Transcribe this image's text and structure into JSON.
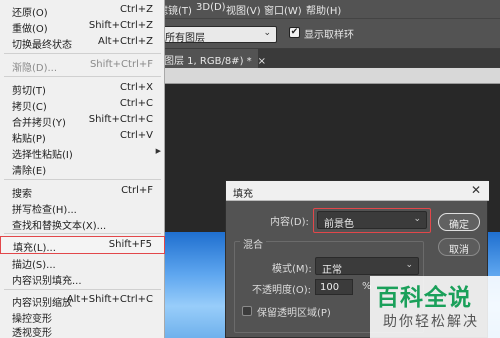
{
  "menubar": {
    "items": [
      "滤镜(T)",
      "3D(D)",
      "视图(V)",
      "窗口(W)",
      "帮助(H)"
    ]
  },
  "options_bar": {
    "sample_select_value": "所有图层",
    "show_ring_label": "显示取样环",
    "show_ring_checked": "✔"
  },
  "document_tab": {
    "label": "图层 1, RGB/8#) *",
    "close": "×"
  },
  "edit_menu": {
    "items": [
      {
        "label": "还原(O)",
        "shortcut": "Ctrl+Z"
      },
      {
        "label": "重做(O)",
        "shortcut": "Shift+Ctrl+Z"
      },
      {
        "label": "切换最终状态",
        "shortcut": "Alt+Ctrl+Z"
      },
      {
        "label": "渐隐(D)...",
        "shortcut": "Shift+Ctrl+F"
      },
      {
        "label": "剪切(T)",
        "shortcut": "Ctrl+X"
      },
      {
        "label": "拷贝(C)",
        "shortcut": "Ctrl+C"
      },
      {
        "label": "合并拷贝(Y)",
        "shortcut": "Shift+Ctrl+C"
      },
      {
        "label": "粘贴(P)",
        "shortcut": "Ctrl+V"
      },
      {
        "label": "选择性粘贴(I)",
        "shortcut": ""
      },
      {
        "label": "清除(E)",
        "shortcut": ""
      },
      {
        "label": "搜索",
        "shortcut": "Ctrl+F"
      },
      {
        "label": "拼写检查(H)...",
        "shortcut": ""
      },
      {
        "label": "查找和替换文本(X)...",
        "shortcut": ""
      },
      {
        "label": "填充(L)...",
        "shortcut": "Shift+F5"
      },
      {
        "label": "描边(S)...",
        "shortcut": ""
      },
      {
        "label": "内容识别填充...",
        "shortcut": ""
      },
      {
        "label": "内容识别缩放",
        "shortcut": "Alt+Shift+Ctrl+C"
      },
      {
        "label": "操控变形",
        "shortcut": ""
      },
      {
        "label": "透视变形",
        "shortcut": ""
      }
    ],
    "submenu_arrow": "▶"
  },
  "fill_dialog": {
    "title": "填充",
    "close": "✕",
    "content_label": "内容(D):",
    "content_value": "前景色",
    "blend_group_title": "混合",
    "mode_label": "模式(M):",
    "mode_value": "正常",
    "opacity_label": "不透明度(O):",
    "opacity_value": "100",
    "opacity_unit": "%",
    "preserve_label": "保留透明区域(P)",
    "ok_label": "确定",
    "cancel_label": "取消",
    "chevron": "⌄"
  },
  "watermark": {
    "main": "百科全说",
    "sub": "助你轻松解决"
  },
  "colors": {
    "highlight_red": "#e2474a",
    "ps_panel": "#535353",
    "menu_bg": "#f0f0f0",
    "watermark_green": "#1aa05a"
  }
}
